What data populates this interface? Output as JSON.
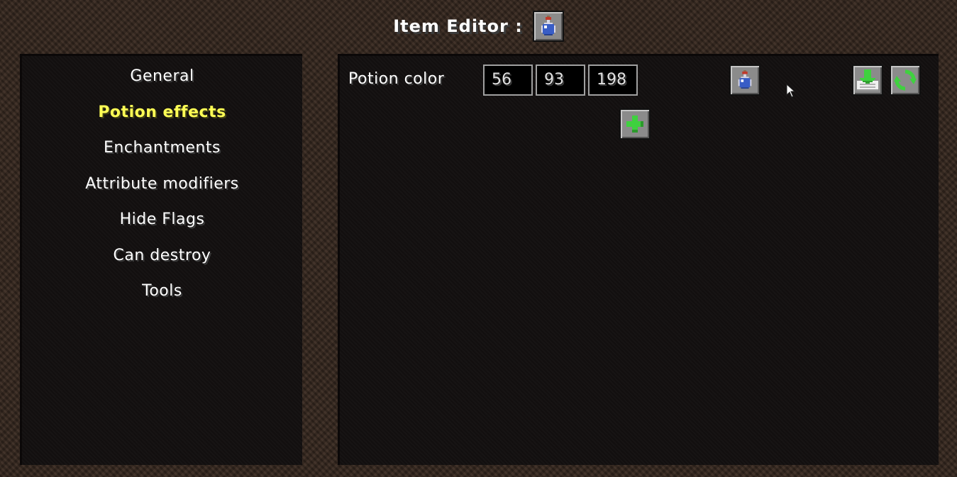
{
  "header": {
    "title": "Item Editor :",
    "item_icon": "potion-bottle-icon"
  },
  "sidebar": {
    "items": [
      {
        "label": "General",
        "active": false
      },
      {
        "label": "Potion effects",
        "active": true
      },
      {
        "label": "Enchantments",
        "active": false
      },
      {
        "label": "Attribute modifiers",
        "active": false
      },
      {
        "label": "Hide Flags",
        "active": false
      },
      {
        "label": "Can destroy",
        "active": false
      },
      {
        "label": "Tools",
        "active": false
      }
    ]
  },
  "potion_panel": {
    "color_label": "Potion color",
    "red": "56",
    "green": "93",
    "blue": "198",
    "preview_icon": "potion-bottle-icon",
    "add_icon": "plus-icon",
    "save_icon": "download-icon",
    "reset_icon": "refresh-icon"
  },
  "colors": {
    "active_menu": "#ffff55",
    "text": "#ffffff",
    "potion": "#385dc6",
    "accent_green": "#3fd13f"
  }
}
